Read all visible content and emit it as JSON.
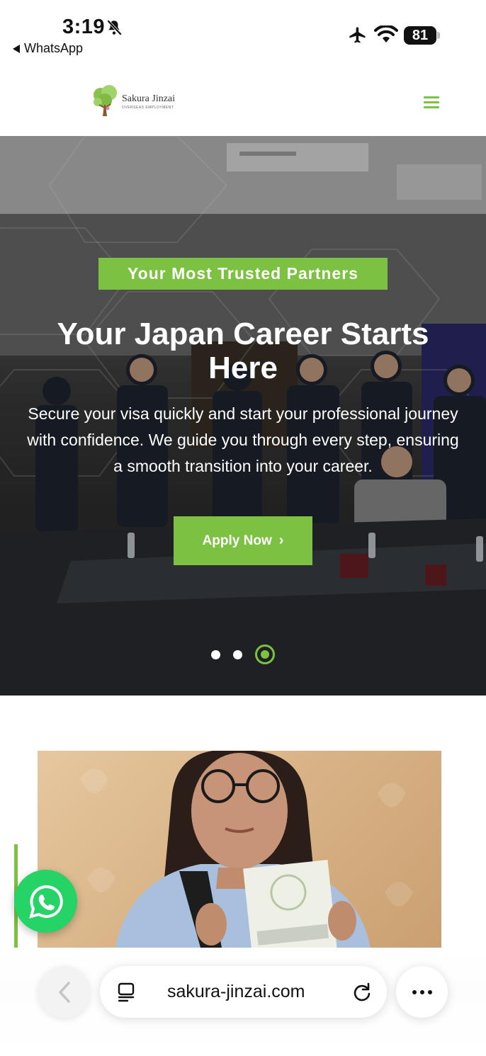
{
  "status_bar": {
    "time": "3:19",
    "back_app": "WhatsApp",
    "battery": "81",
    "icons": [
      "bell-slash-icon",
      "airplane-icon",
      "wifi-icon",
      "battery-icon"
    ]
  },
  "header": {
    "logo_name": "Sakura Jinzai",
    "logo_tagline": "OVERSEAS EMPLOYMENT",
    "menu_icon": "hamburger-menu-icon"
  },
  "hero": {
    "tag": "Your Most Trusted Partners",
    "title": "Your Japan Career Starts Here",
    "description": "Secure your visa quickly and start your professional journey with confidence. We guide you through every step, ensuring a smooth transition into your career.",
    "cta_label": "Apply Now",
    "cta_icon": "chevron-right-icon",
    "slides_total": 3,
    "active_slide": 3
  },
  "floating": {
    "whatsapp_icon": "whatsapp-icon"
  },
  "browser": {
    "url": "sakura-jinzai.com",
    "back_icon": "chevron-left-icon",
    "tabs_icon": "page-menu-icon",
    "reload_icon": "reload-icon",
    "more_icon": "more-dots-icon"
  },
  "colors": {
    "accent": "#7dc142",
    "whatsapp": "#25d366"
  }
}
